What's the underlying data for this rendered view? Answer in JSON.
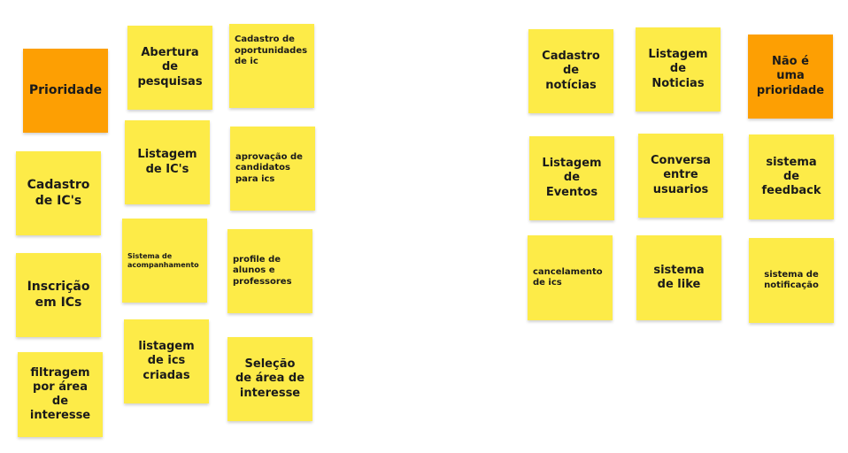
{
  "colors": {
    "sticky_yellow": "#fdeb48",
    "sticky_orange": "#fd9f03",
    "background": "#ffffff"
  },
  "board_left": {
    "priority_label": "Prioridade",
    "notes": [
      "Cadastro\nde IC's",
      "Inscrição\nem ICs",
      "filtragem\npor área\nde\ninteresse",
      "Abertura\nde\npesquisas",
      "Listagem\nde IC's",
      "Sistema de\nacompanhamento",
      "listagem\nde ics\ncriadas",
      "Cadastro de\noportunidades\nde ic",
      "aprovação de\ncandidatos\npara ics",
      "profile de\nalunos e\nprofessores",
      "Seleção\nde área de\ninteresse"
    ]
  },
  "board_right": {
    "not_priority_label": "Não é\numa\nprioridade",
    "notes": [
      "Cadastro\nde\nnotícias",
      "Listagem\nde\nNoticias",
      "Listagem\nde\nEventos",
      "Conversa\nentre\nusuarios",
      "sistema\nde\nfeedback",
      "cancelamento\nde ics",
      "sistema\nde like",
      "sistema de\nnotificação"
    ]
  }
}
